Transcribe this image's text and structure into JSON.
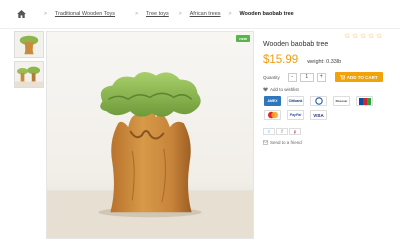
{
  "breadcrumb": {
    "home_icon": "home-icon",
    "items": [
      "Traditional Wooden Toys",
      "Tree toys",
      "African trees"
    ],
    "current": "Wooden baobab tree",
    "separator": ">"
  },
  "product": {
    "badge": "new",
    "title": "Wooden baobab tree",
    "price": "$15.99",
    "weight": "weight: 0.33lb",
    "rating_stars": [
      "☆",
      "☆",
      "☆",
      "☆",
      "☆"
    ]
  },
  "cart": {
    "quantity_label": "Quantity",
    "minus": "-",
    "quantity_value": "1",
    "plus": "+",
    "add_button": "ADD TO CART"
  },
  "wishlist_label": "Add to wishlist",
  "payments": [
    {
      "label": "AMEX",
      "color": "#2e77bc"
    },
    {
      "label": "Citibank",
      "color": "#ffffff"
    },
    {
      "label": "DISCOVER",
      "color": "#ffffff"
    },
    {
      "label": "Discover",
      "color": "#ffffff"
    },
    {
      "label": "JCB",
      "color": "#ffffff"
    },
    {
      "label": "MC",
      "color": "#ffffff"
    },
    {
      "label": "PayPal",
      "color": "#ffffff"
    },
    {
      "label": "VISA",
      "color": "#ffffff"
    }
  ],
  "social": [
    "t",
    "f",
    "p"
  ],
  "send_to_friend": "Send to a friend",
  "colors": {
    "price": "#f39c12",
    "add_to_cart": "#f0a30a",
    "badge": "#58b44b"
  }
}
